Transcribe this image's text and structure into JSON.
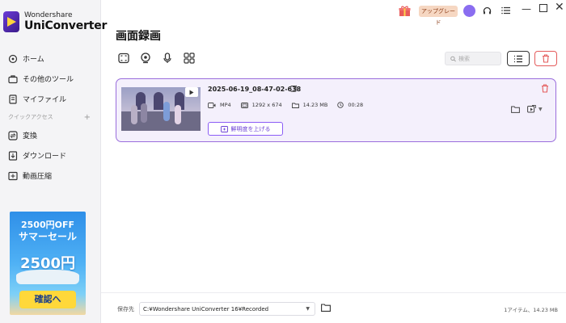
{
  "brand": {
    "top": "Wondershare",
    "name": "UniConverter"
  },
  "sidebar": {
    "items": [
      {
        "label": "ホーム"
      },
      {
        "label": "その他のツール"
      },
      {
        "label": "マイファイル"
      }
    ],
    "section_label": "クイックアクセス",
    "section_plus": "+",
    "quick_items": [
      {
        "label": "変換"
      },
      {
        "label": "ダウンロード"
      },
      {
        "label": "動画圧縮"
      }
    ],
    "promo": {
      "line1": "2500円OFF",
      "line2": "サマーセール",
      "big": "2500円",
      "button": "確認へ"
    }
  },
  "topbar": {
    "upgrade_label": "アップグレード",
    "min": "—",
    "close": "✕"
  },
  "main": {
    "title": "画面録画",
    "search_placeholder": "検索",
    "file": {
      "name": "2025-06-19_08-47-02-638",
      "format": "MP4",
      "resolution": "1292 x 674",
      "size": "14.23 MB",
      "duration": "00:28",
      "enhance_label": "鮮明度を上げる"
    }
  },
  "bottom": {
    "save_label": "保存先",
    "path": "C:¥Wondershare UniConverter 16¥Recorded",
    "status": "1アイテム、14.23 MB"
  },
  "colors": {
    "accent": "#8b5cf6",
    "danger": "#e45b5b",
    "upgrade_bg": "#f6d7c2",
    "promo_button": "#ffd83a"
  }
}
